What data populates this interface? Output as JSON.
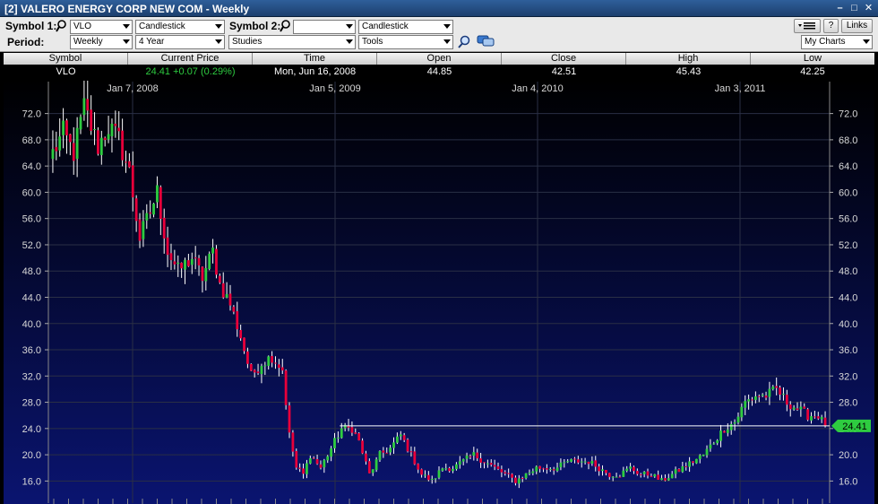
{
  "window": {
    "title": "[2] VALERO ENERGY CORP NEW COM - Weekly",
    "buttons": [
      "–",
      "□",
      "✕"
    ]
  },
  "toolbar": {
    "symbol1_label": "Symbol 1:",
    "symbol1_value": "VLO",
    "chart_type1": "Candlestick",
    "symbol2_label": "Symbol 2:",
    "symbol2_value": "",
    "chart_type2": "Candlestick",
    "period_label": "Period:",
    "period_value": "Weekly",
    "range_value": "4 Year",
    "studies_value": "Studies",
    "tools_value": "Tools",
    "help_label": "?",
    "links_label": "Links",
    "my_charts_value": "My Charts"
  },
  "quote": {
    "headers": [
      "Symbol",
      "Current Price",
      "Time",
      "Open",
      "Close",
      "High",
      "Low"
    ],
    "symbol": "VLO",
    "current_price": "24.41",
    "change": "+0.07 (0.29%)",
    "time": "Mon, Jun 16, 2008",
    "open": "44.85",
    "close": "42.51",
    "high": "45.43",
    "low": "42.25"
  },
  "colors": {
    "up": "#2ecc40",
    "down": "#e8003a",
    "wick": "#ffffff",
    "bg_top": "#000000",
    "bg_bottom": "#0a1470",
    "price_marker": "#2ecc40"
  },
  "chart_data": {
    "type": "candlestick",
    "title": "VALERO ENERGY CORP NEW COM",
    "x_date_labels": [
      "Jan 7, 2008",
      "Jan 5, 2009",
      "Jan 4, 2010",
      "Jan 3, 2011"
    ],
    "y_ticks": [
      16.0,
      20.0,
      24.0,
      28.0,
      32.0,
      36.0,
      40.0,
      44.0,
      48.0,
      52.0,
      56.0,
      60.0,
      64.0,
      68.0,
      72.0
    ],
    "ylim": [
      14.0,
      75.5
    ],
    "current_price_label": "24.41",
    "current_price": 24.41,
    "grid": true,
    "weekly_close_anchors": [
      [
        0,
        66
      ],
      [
        3,
        69
      ],
      [
        6,
        66
      ],
      [
        9,
        73
      ],
      [
        11,
        70
      ],
      [
        13,
        67
      ],
      [
        16,
        70
      ],
      [
        19,
        68
      ],
      [
        22,
        63
      ],
      [
        25,
        53
      ],
      [
        28,
        57
      ],
      [
        30,
        60
      ],
      [
        33,
        51
      ],
      [
        36,
        48
      ],
      [
        40,
        50
      ],
      [
        43,
        47
      ],
      [
        46,
        51
      ],
      [
        48,
        46
      ],
      [
        51,
        43
      ],
      [
        54,
        38
      ],
      [
        57,
        32
      ],
      [
        60,
        34
      ],
      [
        63,
        35
      ],
      [
        66,
        33
      ],
      [
        68,
        23
      ],
      [
        70,
        18
      ],
      [
        72,
        17
      ],
      [
        74,
        20
      ],
      [
        77,
        18
      ],
      [
        80,
        21
      ],
      [
        83,
        24
      ],
      [
        86,
        24
      ],
      [
        88,
        22
      ],
      [
        91,
        17
      ],
      [
        94,
        20
      ],
      [
        97,
        21
      ],
      [
        100,
        23
      ],
      [
        103,
        20
      ],
      [
        106,
        17
      ],
      [
        109,
        16
      ],
      [
        112,
        18
      ],
      [
        115,
        18
      ],
      [
        118,
        19
      ],
      [
        121,
        20
      ],
      [
        124,
        19
      ],
      [
        127,
        18
      ],
      [
        130,
        17
      ],
      [
        133,
        16
      ],
      [
        136,
        17
      ],
      [
        139,
        18
      ],
      [
        142,
        18
      ],
      [
        145,
        18
      ],
      [
        148,
        19
      ],
      [
        151,
        19
      ],
      [
        154,
        19
      ],
      [
        157,
        18
      ],
      [
        160,
        17
      ],
      [
        163,
        17
      ],
      [
        166,
        18
      ],
      [
        169,
        17
      ],
      [
        172,
        17
      ],
      [
        175,
        16
      ],
      [
        178,
        17
      ],
      [
        181,
        18
      ],
      [
        184,
        19
      ],
      [
        187,
        20
      ],
      [
        190,
        22
      ],
      [
        193,
        24
      ],
      [
        196,
        25
      ],
      [
        199,
        28
      ],
      [
        202,
        29
      ],
      [
        205,
        29
      ],
      [
        208,
        30
      ],
      [
        211,
        28
      ],
      [
        214,
        27
      ],
      [
        217,
        26
      ],
      [
        220,
        26
      ],
      [
        222,
        24.41
      ]
    ]
  }
}
